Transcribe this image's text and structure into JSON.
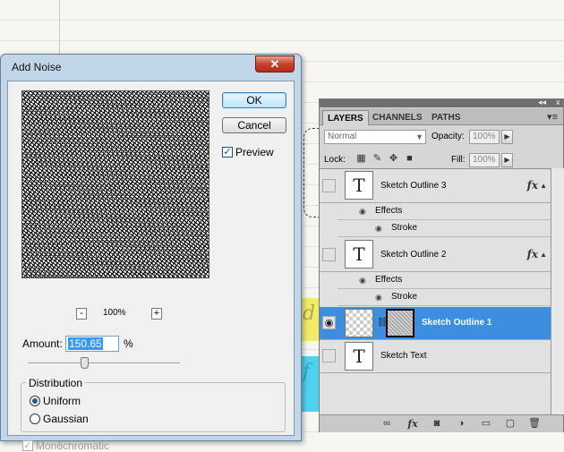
{
  "dialog": {
    "title": "Add Noise",
    "close_label": "✕",
    "ok_label": "OK",
    "cancel_label": "Cancel",
    "preview_label": "Preview",
    "preview_checked": true,
    "zoom_minus": "-",
    "zoom_plus": "+",
    "zoom_level": "100%",
    "amount_label": "Amount:",
    "amount_value": "150.65",
    "amount_unit": "%",
    "distribution_label": "Distribution",
    "uniform_label": "Uniform",
    "gaussian_label": "Gaussian",
    "selected_distribution": "Uniform",
    "monochromatic_label": "Monochromatic",
    "monochromatic_checked": true
  },
  "panel": {
    "collapse_glyph": "◂◂",
    "close_glyph": "x",
    "tabs": [
      {
        "label": "LAYERS",
        "active": true
      },
      {
        "label": "CHANNELS",
        "active": false
      },
      {
        "label": "PATHS",
        "active": false
      }
    ],
    "blend_mode": "Normal",
    "opacity_label": "Opacity:",
    "opacity_value": "100%",
    "lock_label": "Lock:",
    "fill_label": "Fill:",
    "fill_value": "100%",
    "layers": [
      {
        "name": "Sketch Outline 3",
        "fx": "fx",
        "effects_label": "Effects",
        "stroke_label": "Stroke",
        "visible": false
      },
      {
        "name": "Sketch Outline 2",
        "fx": "fx",
        "effects_label": "Effects",
        "stroke_label": "Stroke",
        "visible": false
      },
      {
        "name": "Sketch Outline 1",
        "visible": true,
        "selected": true
      },
      {
        "name": "Sketch Text",
        "visible": false
      }
    ],
    "type_thumb_glyph": "T"
  },
  "colors": {
    "selection_blue": "#3c8fe0",
    "close_red": "#c7432e",
    "yellow_strip": "#f2ea6b",
    "cyan_strip": "#4fd2ef"
  }
}
